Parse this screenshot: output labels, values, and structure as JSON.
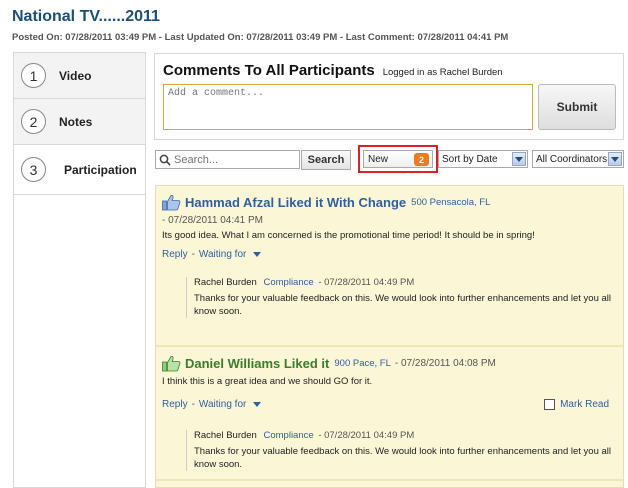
{
  "page": {
    "title": "National TV......2011",
    "meta": "Posted On: 07/28/2011 03:49 PM - Last Updated On: 07/28/2011 03:49 PM - Last Comment: 07/28/2011 04:41 PM"
  },
  "nav": {
    "items": [
      {
        "number": "1",
        "label": "Video"
      },
      {
        "number": "2",
        "label": "Notes"
      },
      {
        "number": "3",
        "label": "Participation"
      }
    ]
  },
  "comment_box": {
    "title": "Comments To All Participants",
    "logged_in": "Logged in as Rachel Burden",
    "placeholder": "Add a comment...",
    "submit_label": "Submit"
  },
  "toolbar": {
    "search_placeholder": "Search...",
    "search_button": "Search",
    "new_filter_label": "New",
    "new_count": "2",
    "sort_value": "Sort by Date",
    "coordinator_value": "All Coordinators"
  },
  "colors": {
    "accent_orange": "#f07b1e",
    "highlight_red": "#e02020",
    "link_blue": "#2e5fa4",
    "title_blue": "#1b4f7a",
    "feed_background": "#fbf6d6",
    "liked_green": "#3a7d2a"
  },
  "posts": [
    {
      "icon": "thumbs-up-icon",
      "title": "Hammad Afzal Liked it With Change",
      "location": "500 Pensacola, FL",
      "date": "- 07/28/2011 04:41 PM",
      "body": "Its good idea. What I am concerned is the promotional time period! It should be in spring!",
      "reply_label": "Reply",
      "waiting_label": "Waiting for",
      "reply": {
        "author": "Rachel Burden",
        "role": "Compliance",
        "date": "- 07/28/2011 04:49 PM",
        "text": "Thanks for your valuable feedback on this. We would look into further enhancements and let you all know soon."
      }
    },
    {
      "icon": "thumbs-up-icon",
      "title": "Daniel Williams Liked it",
      "location": "900 Pace, FL",
      "date": "- 07/28/2011 04:08 PM",
      "body": "I think this is a great idea and we should GO for it.",
      "reply_label": "Reply",
      "waiting_label": "Waiting for",
      "mark_read_label": "Mark Read",
      "reply": {
        "author": "Rachel Burden",
        "role": "Compliance",
        "date": "- 07/28/2011 04:49 PM",
        "text": "Thanks for your valuable feedback on this. We would look into further enhancements and let you all know soon."
      }
    }
  ]
}
